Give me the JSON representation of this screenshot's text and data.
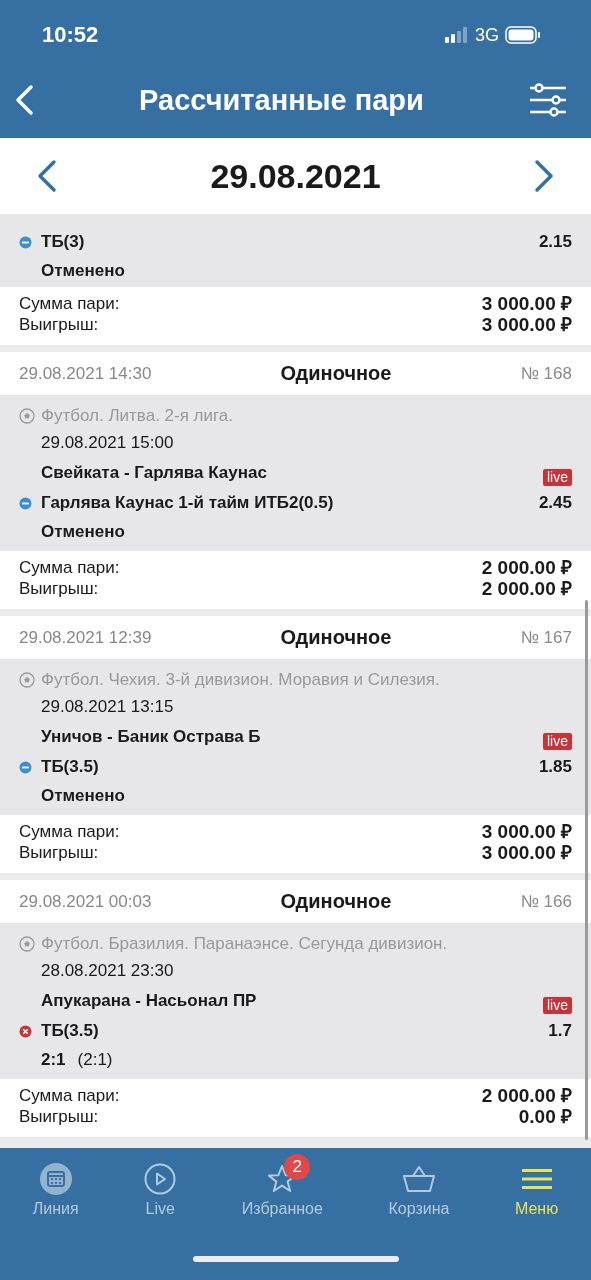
{
  "status_bar": {
    "time": "10:52",
    "network": "3G"
  },
  "header": {
    "title": "Рассчитанные пари"
  },
  "date_nav": {
    "date": "29.08.2021"
  },
  "bets": [
    {
      "selections": [
        {
          "kind": "cancelled",
          "market": "ТБ(3)",
          "odds": "2.15",
          "result": "Отменено"
        }
      ],
      "stake_label": "Сумма пари:",
      "stake": "3 000.00 ₽",
      "win_label": "Выигрыш:",
      "win": "3 000.00 ₽"
    },
    {
      "placed": "29.08.2021 14:30",
      "type": "Одиночное",
      "number": "№ 168",
      "sport": "Футбол. Литва. 2-я лига.",
      "start": "29.08.2021 15:00",
      "teams": "Свейката - Гарлява Каунас",
      "live": "live",
      "selections": [
        {
          "kind": "cancelled",
          "market": "Гарлява Каунас 1-й тайм ИТБ2(0.5)",
          "odds": "2.45",
          "result": "Отменено"
        }
      ],
      "stake_label": "Сумма пари:",
      "stake": "2 000.00 ₽",
      "win_label": "Выигрыш:",
      "win": "2 000.00 ₽"
    },
    {
      "placed": "29.08.2021 12:39",
      "type": "Одиночное",
      "number": "№ 167",
      "sport": "Футбол. Чехия. 3-й дивизион. Моравия и Силезия.",
      "start": "29.08.2021 13:15",
      "teams": "Уничов - Баник Острава Б",
      "live": "live",
      "selections": [
        {
          "kind": "cancelled",
          "market": "ТБ(3.5)",
          "odds": "1.85",
          "result": "Отменено"
        }
      ],
      "stake_label": "Сумма пари:",
      "stake": "3 000.00 ₽",
      "win_label": "Выигрыш:",
      "win": "3 000.00 ₽"
    },
    {
      "placed": "29.08.2021 00:03",
      "type": "Одиночное",
      "number": "№ 166",
      "sport": "Футбол. Бразилия. Паранаэнсе. Сегунда дивизион.",
      "start": "28.08.2021 23:30",
      "teams": "Апукарана - Насьонал ПР",
      "live": "live",
      "selections": [
        {
          "kind": "lost",
          "market": "ТБ(3.5)",
          "odds": "1.7",
          "result": "2:1",
          "result_detail": "(2:1)"
        }
      ],
      "stake_label": "Сумма пари:",
      "stake": "2 000.00 ₽",
      "win_label": "Выигрыш:",
      "win": "0.00 ₽"
    }
  ],
  "tab_bar": [
    {
      "kind": "calendar",
      "label": "Линия",
      "selected": false
    },
    {
      "kind": "play",
      "label": "Live",
      "selected": false
    },
    {
      "kind": "star",
      "label": "Избранное",
      "selected": false,
      "badge": "2"
    },
    {
      "kind": "basket",
      "label": "Корзина",
      "selected": false
    },
    {
      "kind": "menu",
      "label": "Меню",
      "selected": true
    }
  ]
}
